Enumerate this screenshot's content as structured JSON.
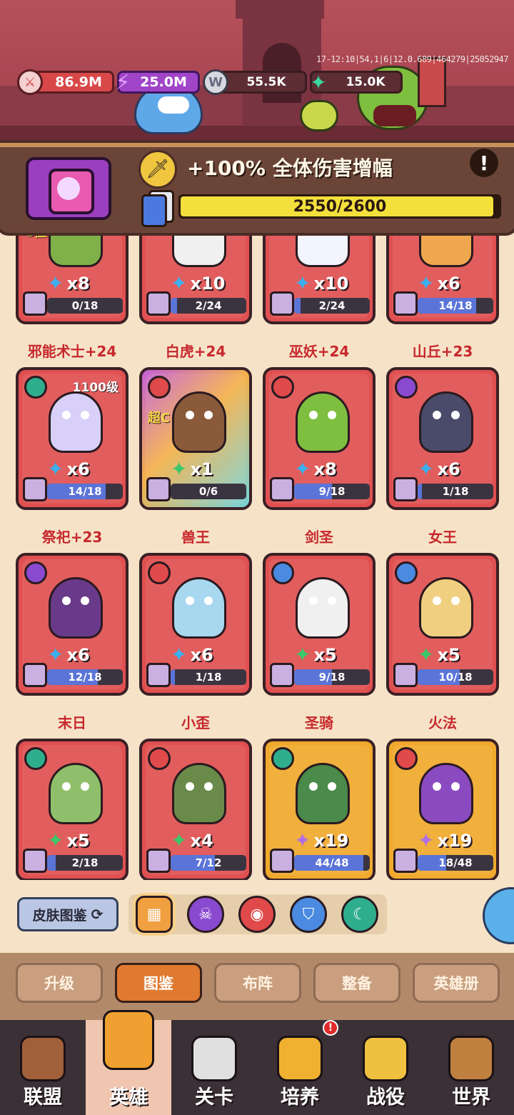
{
  "header": {
    "debug": "17-12:10|54,1|6|12.0.689|464279|25052947",
    "resources": {
      "attack": "86.9M",
      "energy": "25.0M",
      "coins": "55.5K",
      "gems": "15.0K"
    },
    "coin_letter": "W"
  },
  "buff": {
    "text": "+100% 全体伤害增幅",
    "info": "!",
    "progress_text": "2550/2600",
    "progress": 0.981
  },
  "heroes": [
    {
      "name": "邪能术士+24",
      "mult": "x8",
      "prog": "0/18",
      "class": "purple",
      "grade": "C位",
      "star": "blue",
      "card": "red"
    },
    {
      "name": "白虎+24",
      "mult": "x10",
      "prog": "2/24",
      "class": "teal",
      "star": "blue",
      "card": "red"
    },
    {
      "name": "巫妖+24",
      "mult": "x10",
      "prog": "2/24",
      "class": "purple",
      "star": "blue",
      "card": "red"
    },
    {
      "name": "山丘+23",
      "mult": "x6",
      "prog": "14/18",
      "class": "blue",
      "star": "blue",
      "card": "red"
    },
    {
      "name": "祭祀+23",
      "mult": "x6",
      "prog": "14/18",
      "class": "teal",
      "level": "1100级",
      "star": "blue",
      "card": "red"
    },
    {
      "name": "兽王",
      "mult": "x1",
      "prog": "0/6",
      "class": "red",
      "grade": "超C",
      "star": "green",
      "card": "super"
    },
    {
      "name": "剑圣",
      "mult": "x8",
      "prog": "9/18",
      "class": "red",
      "star": "blue",
      "card": "red"
    },
    {
      "name": "女王",
      "mult": "x6",
      "prog": "1/18",
      "class": "purple",
      "star": "blue",
      "card": "red"
    },
    {
      "name": "末日",
      "mult": "x6",
      "prog": "12/18",
      "class": "purple",
      "star": "blue",
      "card": "red"
    },
    {
      "name": "小歪",
      "mult": "x6",
      "prog": "1/18",
      "class": "red",
      "star": "blue",
      "card": "red"
    },
    {
      "name": "圣骑",
      "mult": "x5",
      "prog": "9/18",
      "class": "blue",
      "star": "green",
      "card": "red"
    },
    {
      "name": "火法",
      "mult": "x5",
      "prog": "10/18",
      "class": "blue",
      "star": "green",
      "card": "red"
    },
    {
      "name": "",
      "mult": "x5",
      "prog": "2/18",
      "class": "teal",
      "star": "green",
      "card": "red"
    },
    {
      "name": "",
      "mult": "x4",
      "prog": "7/12",
      "class": "red",
      "star": "green",
      "card": "red"
    },
    {
      "name": "",
      "mult": "x19",
      "prog": "44/48",
      "class": "teal",
      "star": "purple",
      "card": "gold"
    },
    {
      "name": "",
      "mult": "x19",
      "prog": "18/48",
      "class": "red",
      "star": "purple",
      "card": "gold"
    }
  ],
  "filters": {
    "skin_label": "皮肤图鉴",
    "items": [
      "all",
      "purple-skull",
      "red-mask",
      "blue-helmet",
      "teal-moon"
    ]
  },
  "subtabs": [
    "升级",
    "图鉴",
    "布阵",
    "整备",
    "英雄册"
  ],
  "subtab_active": 1,
  "nav": [
    "联盟",
    "英雄",
    "关卡",
    "培养",
    "战役",
    "世界"
  ],
  "nav_active": 1,
  "nav_badge": "!",
  "colors": {
    "accent": "#e07a30",
    "card_red": "#e05050",
    "progress_fill": "#f4e03c",
    "name_red": "#c7282d"
  }
}
